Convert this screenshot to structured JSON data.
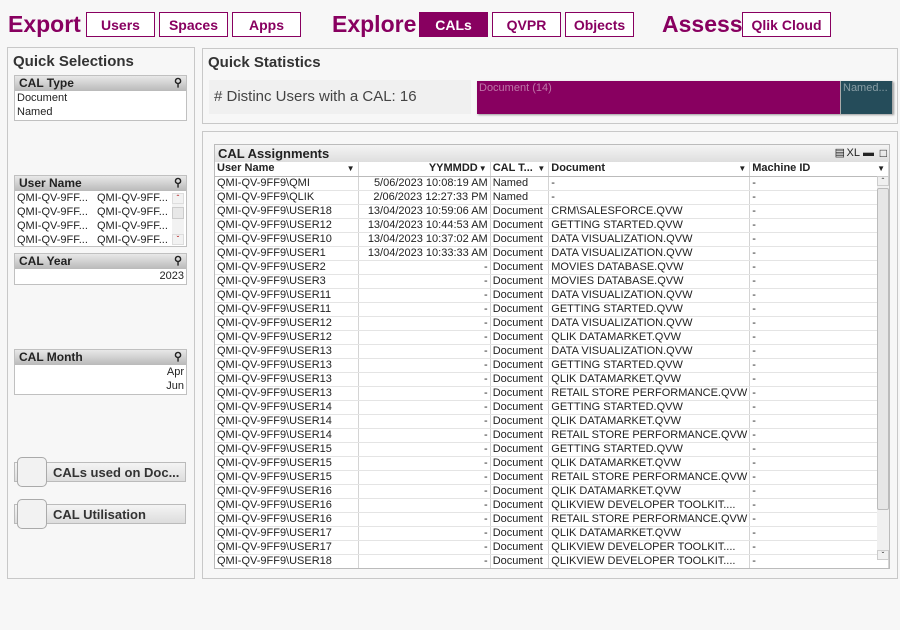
{
  "nav": {
    "export_label": "Export",
    "export_buttons": [
      "Users",
      "Spaces",
      "Apps"
    ],
    "explore_label": "Explore",
    "explore_buttons": [
      "CALs",
      "QVPR",
      "Objects"
    ],
    "assess_label": "Assess",
    "assess_buttons": [
      "Qlik Cloud"
    ],
    "active": "CALs",
    "accent": "#880060"
  },
  "quick_selections": {
    "title": "Quick Selections",
    "cal_type": {
      "title": "CAL Type",
      "items": [
        "Document",
        "Named"
      ]
    },
    "user_name": {
      "title": "User Name",
      "items": [
        "QMI-QV-9FF...",
        "QMI-QV-9FF...",
        "QMI-QV-9FF...",
        "QMI-QV-9FF...",
        "QMI-QV-9FF...",
        "QMI-QV-9FF...",
        "QMI-QV-9FF...",
        "QMI-QV-9FF..."
      ]
    },
    "cal_year": {
      "title": "CAL Year",
      "items": [
        "2023"
      ]
    },
    "cal_month": {
      "title": "CAL Month",
      "items": [
        "Apr",
        "Jun"
      ]
    },
    "buttons": [
      "CALs used on Doc...",
      "CAL Utilisation"
    ]
  },
  "quick_statistics": {
    "title": "Quick Statistics",
    "distinct_users": "# Distinc Users with a CAL: 16",
    "bar": [
      {
        "label": "Document (14)",
        "value": 14,
        "color": "#880060"
      },
      {
        "label": "Named...",
        "value": 2,
        "color": "#254c5a"
      }
    ]
  },
  "cal_assignments": {
    "title": "CAL Assignments",
    "toolbar": [
      "print-icon",
      "XL",
      "minimize-icon",
      "maximize-icon"
    ],
    "xl_label": "XL",
    "columns": [
      "User Name",
      "YYMMDD",
      "CAL T...",
      "Document",
      "Machine ID"
    ],
    "rows": [
      [
        "QMI-QV-9FF9\\QMI",
        "5/06/2023 10:08:19 AM",
        "Named",
        "-",
        "-"
      ],
      [
        "QMI-QV-9FF9\\QLIK",
        "2/06/2023 12:27:33 PM",
        "Named",
        "-",
        "-"
      ],
      [
        "QMI-QV-9FF9\\USER18",
        "13/04/2023 10:59:06 AM",
        "Document",
        "CRM\\SALESFORCE.QVW",
        "-"
      ],
      [
        "QMI-QV-9FF9\\USER12",
        "13/04/2023 10:44:53 AM",
        "Document",
        "GETTING STARTED.QVW",
        "-"
      ],
      [
        "QMI-QV-9FF9\\USER10",
        "13/04/2023 10:37:02 AM",
        "Document",
        "DATA VISUALIZATION.QVW",
        "-"
      ],
      [
        "QMI-QV-9FF9\\USER1",
        "13/04/2023 10:33:33 AM",
        "Document",
        "DATA VISUALIZATION.QVW",
        "-"
      ],
      [
        "QMI-QV-9FF9\\USER2",
        "-",
        "Document",
        "MOVIES DATABASE.QVW",
        "-"
      ],
      [
        "QMI-QV-9FF9\\USER3",
        "-",
        "Document",
        "MOVIES DATABASE.QVW",
        "-"
      ],
      [
        "QMI-QV-9FF9\\USER11",
        "-",
        "Document",
        "DATA VISUALIZATION.QVW",
        "-"
      ],
      [
        "QMI-QV-9FF9\\USER11",
        "-",
        "Document",
        "GETTING STARTED.QVW",
        "-"
      ],
      [
        "QMI-QV-9FF9\\USER12",
        "-",
        "Document",
        "DATA VISUALIZATION.QVW",
        "-"
      ],
      [
        "QMI-QV-9FF9\\USER12",
        "-",
        "Document",
        "QLIK DATAMARKET.QVW",
        "-"
      ],
      [
        "QMI-QV-9FF9\\USER13",
        "-",
        "Document",
        "DATA VISUALIZATION.QVW",
        "-"
      ],
      [
        "QMI-QV-9FF9\\USER13",
        "-",
        "Document",
        "GETTING STARTED.QVW",
        "-"
      ],
      [
        "QMI-QV-9FF9\\USER13",
        "-",
        "Document",
        "QLIK DATAMARKET.QVW",
        "-"
      ],
      [
        "QMI-QV-9FF9\\USER13",
        "-",
        "Document",
        "RETAIL STORE PERFORMANCE.QVW",
        "-"
      ],
      [
        "QMI-QV-9FF9\\USER14",
        "-",
        "Document",
        "GETTING STARTED.QVW",
        "-"
      ],
      [
        "QMI-QV-9FF9\\USER14",
        "-",
        "Document",
        "QLIK DATAMARKET.QVW",
        "-"
      ],
      [
        "QMI-QV-9FF9\\USER14",
        "-",
        "Document",
        "RETAIL STORE PERFORMANCE.QVW",
        "-"
      ],
      [
        "QMI-QV-9FF9\\USER15",
        "-",
        "Document",
        "GETTING STARTED.QVW",
        "-"
      ],
      [
        "QMI-QV-9FF9\\USER15",
        "-",
        "Document",
        "QLIK DATAMARKET.QVW",
        "-"
      ],
      [
        "QMI-QV-9FF9\\USER15",
        "-",
        "Document",
        "RETAIL STORE PERFORMANCE.QVW",
        "-"
      ],
      [
        "QMI-QV-9FF9\\USER16",
        "-",
        "Document",
        "QLIK DATAMARKET.QVW",
        "-"
      ],
      [
        "QMI-QV-9FF9\\USER16",
        "-",
        "Document",
        "QLIKVIEW DEVELOPER TOOLKIT....",
        "-"
      ],
      [
        "QMI-QV-9FF9\\USER16",
        "-",
        "Document",
        "RETAIL STORE PERFORMANCE.QVW",
        "-"
      ],
      [
        "QMI-QV-9FF9\\USER17",
        "-",
        "Document",
        "QLIK DATAMARKET.QVW",
        "-"
      ],
      [
        "QMI-QV-9FF9\\USER17",
        "-",
        "Document",
        "QLIKVIEW DEVELOPER TOOLKIT....",
        "-"
      ],
      [
        "QMI-QV-9FF9\\USER18",
        "-",
        "Document",
        "QLIKVIEW DEVELOPER TOOLKIT....",
        "-"
      ]
    ]
  }
}
